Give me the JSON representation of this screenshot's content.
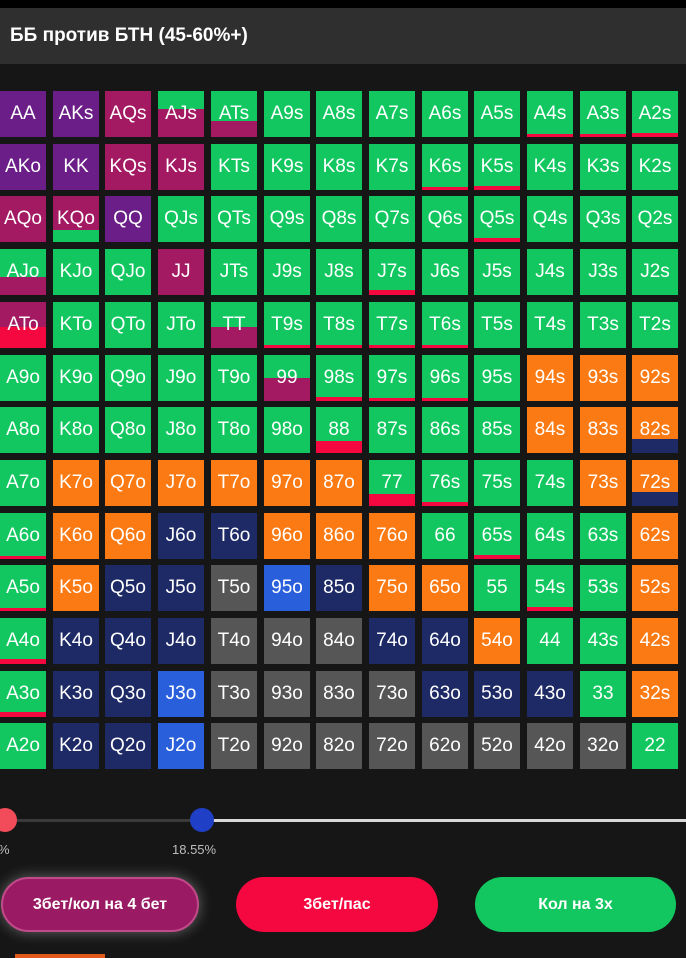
{
  "header": {
    "title": "ББ против БТН (45-60%+)"
  },
  "colors": {
    "green": "#12c760",
    "purple": "#6b1e87",
    "magenta": "#a31a63",
    "red": "#f5083f",
    "orange": "#fb7a13",
    "navy": "#1e2a66",
    "blue": "#2a5fdc",
    "gray": "#565656"
  },
  "hands": [
    [
      "AA",
      "AKs",
      "AQs",
      "AJs",
      "ATs",
      "A9s",
      "A8s",
      "A7s",
      "A6s",
      "A5s",
      "A4s",
      "A3s",
      "A2s"
    ],
    [
      "AKo",
      "KK",
      "KQs",
      "KJs",
      "KTs",
      "K9s",
      "K8s",
      "K7s",
      "K6s",
      "K5s",
      "K4s",
      "K3s",
      "K2s"
    ],
    [
      "AQo",
      "KQo",
      "QQ",
      "QJs",
      "QTs",
      "Q9s",
      "Q8s",
      "Q7s",
      "Q6s",
      "Q5s",
      "Q4s",
      "Q3s",
      "Q2s"
    ],
    [
      "AJo",
      "KJo",
      "QJo",
      "JJ",
      "JTs",
      "J9s",
      "J8s",
      "J7s",
      "J6s",
      "J5s",
      "J4s",
      "J3s",
      "J2s"
    ],
    [
      "ATo",
      "KTo",
      "QTo",
      "JTo",
      "TT",
      "T9s",
      "T8s",
      "T7s",
      "T6s",
      "T5s",
      "T4s",
      "T3s",
      "T2s"
    ],
    [
      "A9o",
      "K9o",
      "Q9o",
      "J9o",
      "T9o",
      "99",
      "98s",
      "97s",
      "96s",
      "95s",
      "94s",
      "93s",
      "92s"
    ],
    [
      "A8o",
      "K8o",
      "Q8o",
      "J8o",
      "T8o",
      "98o",
      "88",
      "87s",
      "86s",
      "85s",
      "84s",
      "83s",
      "82s"
    ],
    [
      "A7o",
      "K7o",
      "Q7o",
      "J7o",
      "T7o",
      "97o",
      "87o",
      "77",
      "76s",
      "75s",
      "74s",
      "73s",
      "72s"
    ],
    [
      "A6o",
      "K6o",
      "Q6o",
      "J6o",
      "T6o",
      "96o",
      "86o",
      "76o",
      "66",
      "65s",
      "64s",
      "63s",
      "62s"
    ],
    [
      "A5o",
      "K5o",
      "Q5o",
      "J5o",
      "T5o",
      "95o",
      "85o",
      "75o",
      "65o",
      "55",
      "54s",
      "53s",
      "52s"
    ],
    [
      "A4o",
      "K4o",
      "Q4o",
      "J4o",
      "T4o",
      "94o",
      "84o",
      "74o",
      "64o",
      "54o",
      "44",
      "43s",
      "42s"
    ],
    [
      "A3o",
      "K3o",
      "Q3o",
      "J3o",
      "T3o",
      "93o",
      "83o",
      "73o",
      "63o",
      "53o",
      "43o",
      "33",
      "32s"
    ],
    [
      "A2o",
      "K2o",
      "Q2o",
      "J2o",
      "T2o",
      "92o",
      "82o",
      "72o",
      "62o",
      "52o",
      "42o",
      "32o",
      "22"
    ]
  ],
  "cell_colors": [
    [
      "P",
      "P",
      "M",
      "M",
      "G",
      "G",
      "G",
      "G",
      "G",
      "G",
      "G",
      "G",
      "G"
    ],
    [
      "P",
      "P",
      "M",
      "M",
      "G",
      "G",
      "G",
      "G",
      "G",
      "G",
      "G",
      "G",
      "G"
    ],
    [
      "M",
      "M",
      "P",
      "G",
      "G",
      "G",
      "G",
      "G",
      "G",
      "G",
      "G",
      "G",
      "G"
    ],
    [
      "G",
      "G",
      "G",
      "M",
      "G",
      "G",
      "G",
      "G",
      "G",
      "G",
      "G",
      "G",
      "G"
    ],
    [
      "M",
      "G",
      "G",
      "G",
      "G",
      "G",
      "G",
      "G",
      "G",
      "G",
      "G",
      "G",
      "G"
    ],
    [
      "G",
      "G",
      "G",
      "G",
      "G",
      "M",
      "G",
      "G",
      "G",
      "G",
      "O",
      "O",
      "O"
    ],
    [
      "G",
      "G",
      "G",
      "G",
      "G",
      "G",
      "G",
      "G",
      "G",
      "G",
      "O",
      "O",
      "O"
    ],
    [
      "G",
      "O",
      "O",
      "O",
      "O",
      "O",
      "O",
      "G",
      "G",
      "G",
      "G",
      "O",
      "O"
    ],
    [
      "G",
      "O",
      "O",
      "N",
      "N",
      "O",
      "O",
      "O",
      "G",
      "G",
      "G",
      "G",
      "O"
    ],
    [
      "G",
      "O",
      "N",
      "N",
      "Y",
      "B",
      "N",
      "O",
      "O",
      "G",
      "G",
      "G",
      "O"
    ],
    [
      "G",
      "N",
      "N",
      "N",
      "Y",
      "Y",
      "Y",
      "N",
      "N",
      "O",
      "G",
      "G",
      "O"
    ],
    [
      "G",
      "N",
      "N",
      "B",
      "Y",
      "Y",
      "Y",
      "Y",
      "N",
      "N",
      "N",
      "G",
      "O"
    ],
    [
      "G",
      "N",
      "N",
      "B",
      "Y",
      "Y",
      "Y",
      "Y",
      "Y",
      "Y",
      "Y",
      "Y",
      "G"
    ]
  ],
  "cell_secondary": [
    {
      "hand": "AJs",
      "color": "M",
      "share": 0.6,
      "secondary": "G"
    },
    {
      "hand": "ATs",
      "color": "M",
      "share": 0.35,
      "secondary": "G"
    },
    {
      "hand": "AJo",
      "color": "M",
      "share": 0.4,
      "secondary": "G"
    },
    {
      "hand": "KQo",
      "color": "G",
      "share": 0.25,
      "secondary": "M"
    },
    {
      "hand": "ATo",
      "color": "R",
      "share": 0.45,
      "secondary": "M"
    },
    {
      "hand": "TT",
      "color": "M",
      "share": 0.45,
      "secondary": "G"
    },
    {
      "hand": "99",
      "color": "M",
      "share": 0.5,
      "secondary": "G"
    },
    {
      "hand": "88",
      "color": "R",
      "share": 0.25,
      "secondary": "G"
    },
    {
      "hand": "77",
      "color": "R",
      "share": 0.25,
      "secondary": "G"
    },
    {
      "hand": "82s",
      "color": "N",
      "share": 0.3,
      "secondary": "O"
    },
    {
      "hand": "72s",
      "color": "N",
      "share": 0.3,
      "secondary": "O"
    },
    {
      "hand": "A2s",
      "color": "R",
      "share": 0.08,
      "secondary": "G"
    },
    {
      "hand": "A3s",
      "color": "R",
      "share": 0.06,
      "secondary": "G"
    },
    {
      "hand": "A4s",
      "color": "R",
      "share": 0.06,
      "secondary": "G"
    },
    {
      "hand": "K6s",
      "color": "R",
      "share": 0.06,
      "secondary": "G"
    },
    {
      "hand": "K5s",
      "color": "R",
      "share": 0.08,
      "secondary": "G"
    },
    {
      "hand": "Q5s",
      "color": "R",
      "share": 0.08,
      "secondary": "G"
    },
    {
      "hand": "J7s",
      "color": "R",
      "share": 0.1,
      "secondary": "G"
    },
    {
      "hand": "T9s",
      "color": "R",
      "share": 0.06,
      "secondary": "G"
    },
    {
      "hand": "T8s",
      "color": "R",
      "share": 0.06,
      "secondary": "G"
    },
    {
      "hand": "T7s",
      "color": "R",
      "share": 0.06,
      "secondary": "G"
    },
    {
      "hand": "T6s",
      "color": "R",
      "share": 0.06,
      "secondary": "G"
    },
    {
      "hand": "98s",
      "color": "R",
      "share": 0.08,
      "secondary": "G"
    },
    {
      "hand": "97s",
      "color": "R",
      "share": 0.06,
      "secondary": "G"
    },
    {
      "hand": "96s",
      "color": "R",
      "share": 0.06,
      "secondary": "G"
    },
    {
      "hand": "76s",
      "color": "R",
      "share": 0.08,
      "secondary": "G"
    },
    {
      "hand": "65s",
      "color": "R",
      "share": 0.08,
      "secondary": "G"
    },
    {
      "hand": "54s",
      "color": "R",
      "share": 0.08,
      "secondary": "G"
    },
    {
      "hand": "A5o",
      "color": "R",
      "share": 0.06,
      "secondary": "G"
    },
    {
      "hand": "A4o",
      "color": "R",
      "share": 0.1,
      "secondary": "G"
    },
    {
      "hand": "A3o",
      "color": "R",
      "share": 0.1,
      "secondary": "G"
    },
    {
      "hand": "A6o",
      "color": "R",
      "share": 0.05,
      "secondary": "G"
    }
  ],
  "slider": {
    "left_label": "%",
    "right_label": "18.55%"
  },
  "buttons": {
    "raise_call": "3бет/кол на 4 бет",
    "raise_fold": "3бет/пас",
    "call": "Кол на 3х"
  }
}
